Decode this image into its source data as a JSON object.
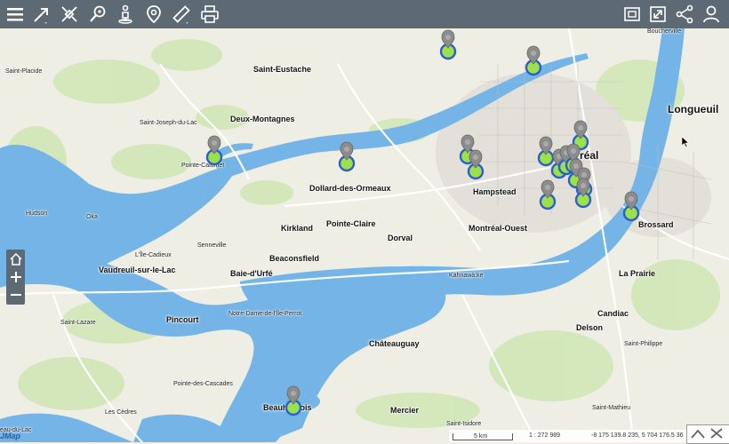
{
  "toolbar": {
    "left_tools": [
      "menu-icon",
      "measure-arrow-icon",
      "satellite-icon",
      "magnify-location-icon",
      "person-pin-icon",
      "location-pin-icon",
      "ruler-pencil-icon",
      "printer-icon"
    ],
    "right_tools": [
      "window-icon",
      "fullscreen-icon",
      "share-icon",
      "user-icon"
    ]
  },
  "map": {
    "place_labels": [
      {
        "text": "Boucherville",
        "size": "small"
      },
      {
        "text": "Saint-Placide",
        "size": "small"
      },
      {
        "text": "Saint-Eustache",
        "size": "big"
      },
      {
        "text": "Deux-Montagnes",
        "size": "big"
      },
      {
        "text": "Saint-Joseph-du-Lac",
        "size": "small"
      },
      {
        "text": "Longueuil",
        "size": "xl"
      },
      {
        "text": "Pointe-Calumet",
        "size": "small"
      },
      {
        "text": "réal",
        "size": "xl"
      },
      {
        "text": "Dollard-des-Ormeaux",
        "size": "big"
      },
      {
        "text": "Hampstead",
        "size": "big"
      },
      {
        "text": "Hudson",
        "size": "small"
      },
      {
        "text": "Oka",
        "size": "small"
      },
      {
        "text": "Pointe-Claire",
        "size": "big"
      },
      {
        "text": "Kirkland",
        "size": "big"
      },
      {
        "text": "Montréal-Ouest",
        "size": "big"
      },
      {
        "text": "Brossard",
        "size": "big"
      },
      {
        "text": "Dorval",
        "size": "big"
      },
      {
        "text": "Senneville",
        "size": "small"
      },
      {
        "text": "L'Île-Cadieux",
        "size": "small"
      },
      {
        "text": "Beaconsfield",
        "size": "big"
      },
      {
        "text": "Vaudreuil-sur-le-Lac",
        "size": "big"
      },
      {
        "text": "Baie-d'Urfé",
        "size": "big"
      },
      {
        "text": "Kahnawà:ke",
        "size": "small"
      },
      {
        "text": "La Prairie",
        "size": "big"
      },
      {
        "text": "Notre-Dame-de-l'Île-Perrot",
        "size": "small"
      },
      {
        "text": "Pincourt",
        "size": "big"
      },
      {
        "text": "Candiac",
        "size": "big"
      },
      {
        "text": "Saint-Lazare",
        "size": "small"
      },
      {
        "text": "Delson",
        "size": "big"
      },
      {
        "text": "Châteauguay",
        "size": "big"
      },
      {
        "text": "Saint-Philippe",
        "size": "small"
      },
      {
        "text": "Pointe-des-Cascades",
        "size": "small"
      },
      {
        "text": "eau-du-Lac",
        "size": "small"
      },
      {
        "text": "Les Cèdres",
        "size": "small"
      },
      {
        "text": "Beauharnois",
        "size": "big"
      },
      {
        "text": "Mercier",
        "size": "big"
      },
      {
        "text": "Saint-Mathieu",
        "size": "small"
      },
      {
        "text": "Saint-Isidore",
        "size": "small"
      }
    ],
    "markers": 17
  },
  "scalebar": {
    "distance": "5 km",
    "ratio": "1 : 272 989",
    "coords": "-8 175 139.8 235, 5 704 176.5 36"
  },
  "logo": "JMap",
  "colors": {
    "toolbar": "#5e6a73",
    "water": "#74b4e6",
    "marker_green": "#9be14a",
    "marker_ring": "#2d5ecf",
    "pin_gray": "#8c8c8c"
  }
}
